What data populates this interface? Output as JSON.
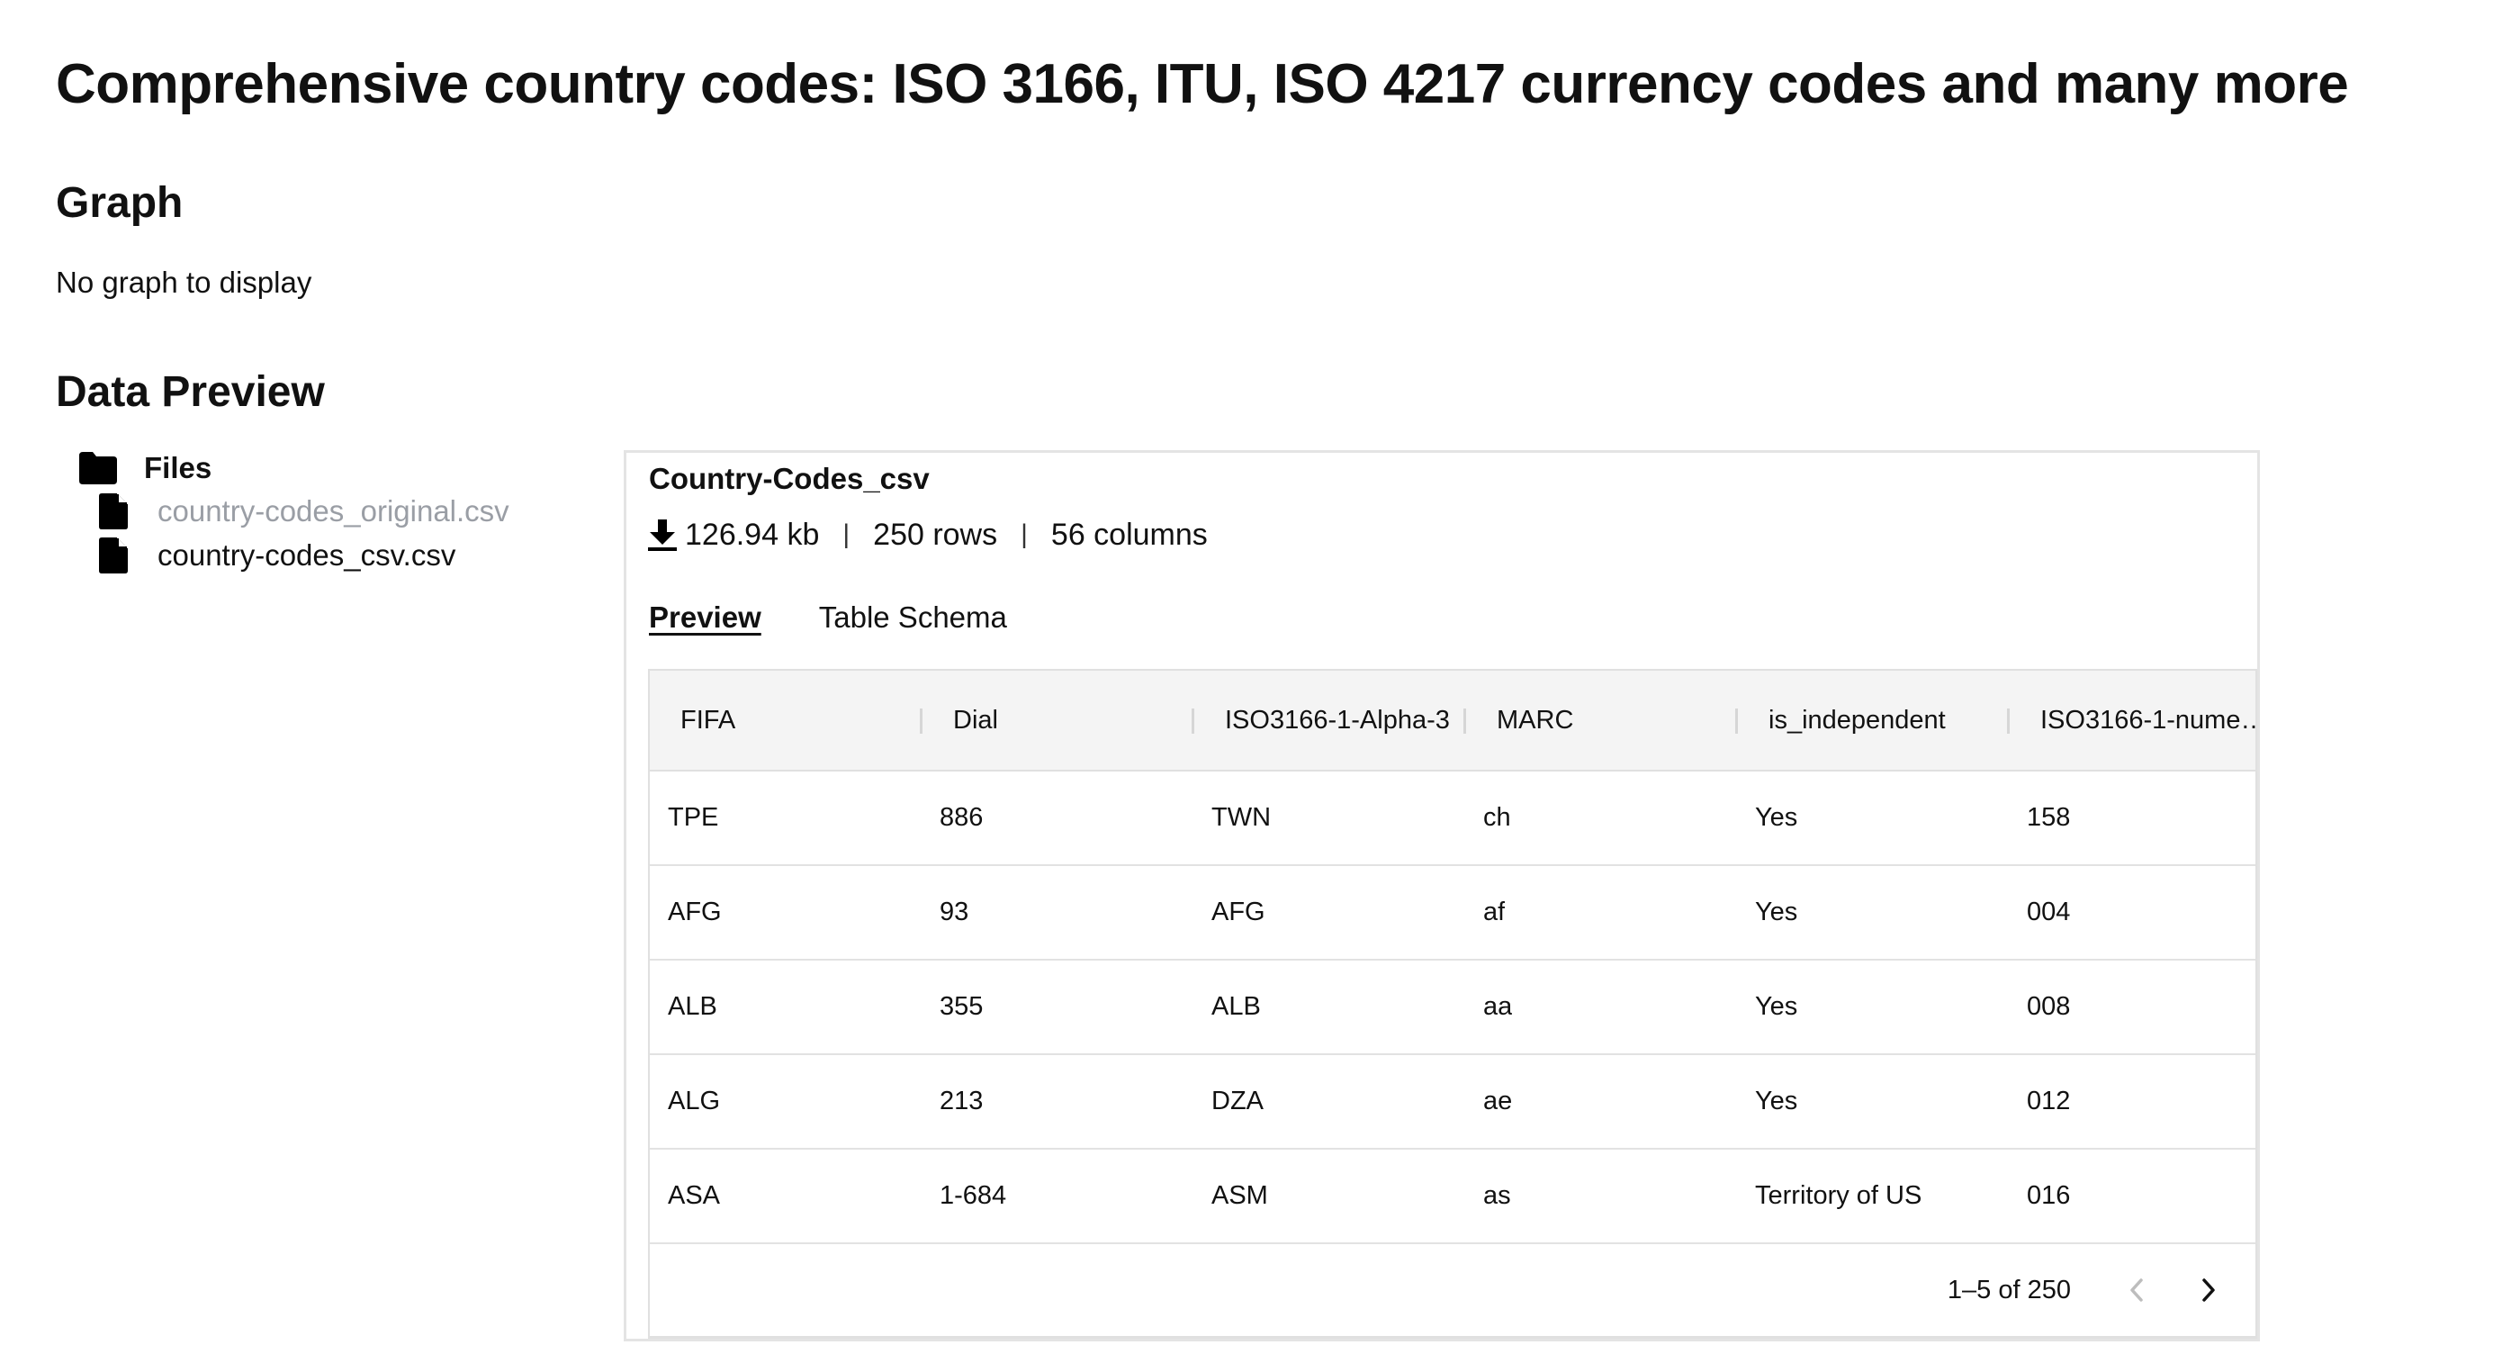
{
  "page": {
    "title": "Comprehensive country codes: ISO 3166, ITU, ISO 4217 currency codes and many more"
  },
  "graph": {
    "heading": "Graph",
    "empty_text": "No graph to display"
  },
  "data_preview": {
    "heading": "Data Preview"
  },
  "files": {
    "folder_label": "Files",
    "items": [
      {
        "name": "country-codes_original.csv"
      },
      {
        "name": "country-codes_csv.csv"
      }
    ]
  },
  "panel": {
    "title": "Country-Codes_csv",
    "size": "126.94 kb",
    "separator": "|",
    "rows": "250 rows",
    "columns": "56 columns",
    "tabs": {
      "preview": "Preview",
      "schema": "Table Schema"
    }
  },
  "table": {
    "columns": [
      "FIFA",
      "Dial",
      "ISO3166-1-Alpha-3",
      "MARC",
      "is_independent",
      "ISO3166-1-nume…"
    ],
    "rows": [
      [
        "TPE",
        "886",
        "TWN",
        "ch",
        "Yes",
        "158"
      ],
      [
        "AFG",
        "93",
        "AFG",
        "af",
        "Yes",
        "004"
      ],
      [
        "ALB",
        "355",
        "ALB",
        "aa",
        "Yes",
        "008"
      ],
      [
        "ALG",
        "213",
        "DZA",
        "ae",
        "Yes",
        "012"
      ],
      [
        "ASA",
        "1-684",
        "ASM",
        "as",
        "Territory of US",
        "016"
      ]
    ],
    "pagination": "1–5 of 250"
  },
  "icons": {
    "folder": "folder-icon",
    "file": "file-icon",
    "download": "download-icon",
    "prev": "chevron-left-icon",
    "next": "chevron-right-icon"
  },
  "colors": {
    "text": "#111111",
    "muted_link": "#9a9ea5",
    "header_bg": "#f4f4f4",
    "border": "#e0e0e0"
  }
}
